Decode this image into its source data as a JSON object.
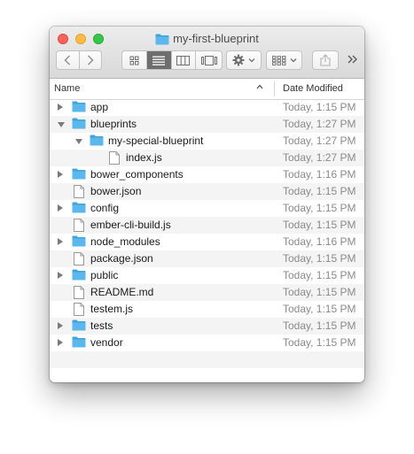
{
  "window": {
    "title": "my-first-blueprint"
  },
  "header": {
    "name_label": "Name",
    "date_label": "Date Modified",
    "sort_indicator": "^"
  },
  "toolbar": {
    "back": "<",
    "forward": ">",
    "overflow": ">>"
  },
  "files": [
    {
      "name": "app",
      "date": "Today, 1:15 PM",
      "kind": "folder",
      "depth": 0,
      "disclosure": "closed"
    },
    {
      "name": "blueprints",
      "date": "Today, 1:27 PM",
      "kind": "folder",
      "depth": 0,
      "disclosure": "open"
    },
    {
      "name": "my-special-blueprint",
      "date": "Today, 1:27 PM",
      "kind": "folder",
      "depth": 1,
      "disclosure": "open"
    },
    {
      "name": "index.js",
      "date": "Today, 1:27 PM",
      "kind": "file",
      "depth": 2,
      "disclosure": "none"
    },
    {
      "name": "bower_components",
      "date": "Today, 1:16 PM",
      "kind": "folder",
      "depth": 0,
      "disclosure": "closed"
    },
    {
      "name": "bower.json",
      "date": "Today, 1:15 PM",
      "kind": "file",
      "depth": 0,
      "disclosure": "none"
    },
    {
      "name": "config",
      "date": "Today, 1:15 PM",
      "kind": "folder",
      "depth": 0,
      "disclosure": "closed"
    },
    {
      "name": "ember-cli-build.js",
      "date": "Today, 1:15 PM",
      "kind": "file",
      "depth": 0,
      "disclosure": "none"
    },
    {
      "name": "node_modules",
      "date": "Today, 1:16 PM",
      "kind": "folder",
      "depth": 0,
      "disclosure": "closed"
    },
    {
      "name": "package.json",
      "date": "Today, 1:15 PM",
      "kind": "file",
      "depth": 0,
      "disclosure": "none"
    },
    {
      "name": "public",
      "date": "Today, 1:15 PM",
      "kind": "folder",
      "depth": 0,
      "disclosure": "closed"
    },
    {
      "name": "README.md",
      "date": "Today, 1:15 PM",
      "kind": "file",
      "depth": 0,
      "disclosure": "none"
    },
    {
      "name": "testem.js",
      "date": "Today, 1:15 PM",
      "kind": "file",
      "depth": 0,
      "disclosure": "none"
    },
    {
      "name": "tests",
      "date": "Today, 1:15 PM",
      "kind": "folder",
      "depth": 0,
      "disclosure": "closed"
    },
    {
      "name": "vendor",
      "date": "Today, 1:15 PM",
      "kind": "folder",
      "depth": 0,
      "disclosure": "closed"
    }
  ],
  "colors": {
    "folder": "#5ab8ec",
    "folder_dark": "#3fa4de",
    "row_alt": "#f4f4f5",
    "date_text": "#8a8a8a"
  }
}
